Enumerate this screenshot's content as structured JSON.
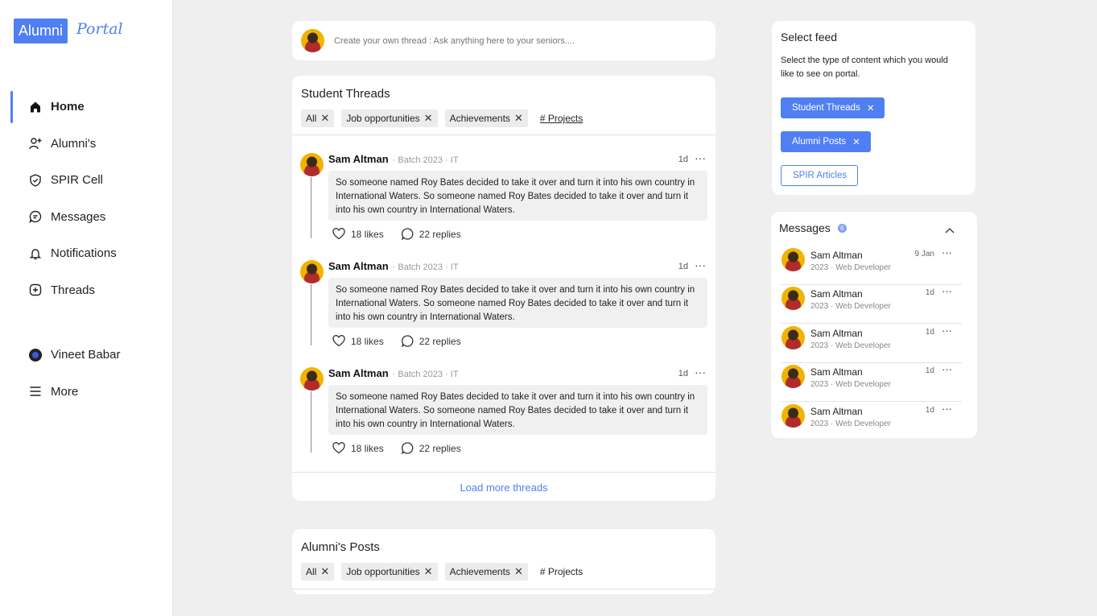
{
  "logo": {
    "box": "Alumni",
    "script": "Portal"
  },
  "nav": {
    "items": [
      {
        "label": "Home",
        "icon": "home-icon"
      },
      {
        "label": "Alumni's",
        "icon": "user-plus-icon"
      },
      {
        "label": "SPIR Cell",
        "icon": "shield-icon"
      },
      {
        "label": "Messages",
        "icon": "message-icon"
      },
      {
        "label": "Notifications",
        "icon": "bell-icon"
      },
      {
        "label": "Threads",
        "icon": "plus-square-icon"
      }
    ],
    "user": "Vineet Babar",
    "more": "More"
  },
  "composer": {
    "placeholder": "Create your own thread : Ask anything here to your seniors...."
  },
  "threads": {
    "title": "Student Threads",
    "filters": [
      "All",
      "Job opportunities",
      "Achievements",
      "# Projects"
    ],
    "items": [
      {
        "name": "Sam Altman",
        "meta": "· Batch 2023 · IT",
        "time": "1d",
        "body": "So someone named Roy Bates decided to take it over and turn it into his own country in International Waters. So someone named Roy Bates decided to take it over and turn it into his own country in International Waters.",
        "likes": "18 likes",
        "replies": "22 replies"
      },
      {
        "name": "Sam Altman",
        "meta": "· Batch 2023 · IT",
        "time": "1d",
        "body": "So someone named Roy Bates decided to take it over and turn it into his own country in International Waters. So someone named Roy Bates decided to take it over and turn it into his own country in International Waters.",
        "likes": "18 likes",
        "replies": "22 replies"
      },
      {
        "name": "Sam Altman",
        "meta": "· Batch 2023 · IT",
        "time": "1d",
        "body": "So someone named Roy Bates decided to take it over and turn it into his own country in International Waters. So someone named Roy Bates decided to take it over and turn it into his own country in International Waters.",
        "likes": "18 likes",
        "replies": "22 replies"
      }
    ],
    "load_more": "Load more threads"
  },
  "alumni_posts": {
    "title": "Alumni's Posts",
    "filters": [
      "All",
      "Job opportunities",
      "Achievements",
      "# Projects"
    ]
  },
  "feed": {
    "title": "Select feed",
    "description": "Select the type of content which you would like to see on portal.",
    "options": [
      {
        "label": "Student Threads",
        "selected": true
      },
      {
        "label": "Alumni Posts",
        "selected": true
      },
      {
        "label": "SPIR Articles",
        "selected": false
      }
    ]
  },
  "messages": {
    "title": "Messages",
    "badge": "6",
    "items": [
      {
        "name": "Sam Altman",
        "sub": "2023 · Web Developer",
        "time": "9 Jan"
      },
      {
        "name": "Sam Altman",
        "sub": "2023 · Web Developer",
        "time": "1d"
      },
      {
        "name": "Sam Altman",
        "sub": "2023 · Web Developer",
        "time": "1d"
      },
      {
        "name": "Sam Altman",
        "sub": "2023 · Web Developer",
        "time": "1d"
      },
      {
        "name": "Sam Altman",
        "sub": "2023 · Web Developer",
        "time": "1d"
      }
    ]
  },
  "colors": {
    "accent": "#4f7ff2",
    "background": "#efefef",
    "card": "#ffffff"
  }
}
